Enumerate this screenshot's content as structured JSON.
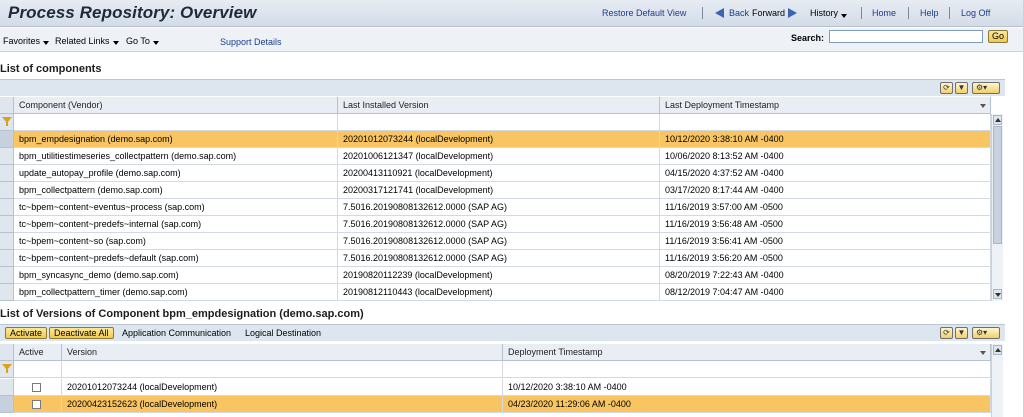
{
  "header": {
    "title": "Process Repository: Overview",
    "restore_default_view": "Restore Default View",
    "back": "Back",
    "forward": "Forward",
    "history": "History",
    "home": "Home",
    "help": "Help",
    "logoff": "Log Off"
  },
  "toolbar": {
    "favorites": "Favorites",
    "related_links": "Related Links",
    "go_to": "Go To",
    "support_details": "Support Details",
    "search_label": "Search:",
    "search_value": "",
    "go_label": "Go"
  },
  "components": {
    "title": "List of components",
    "columns": [
      "Component (Vendor)",
      "Last Installed Version",
      "Last Deployment Timestamp"
    ],
    "rows": [
      {
        "component": "bpm_empdesignation (demo.sap.com)",
        "version": "20201012073244 (localDevelopment)",
        "timestamp": "10/12/2020 3:38:10 AM -0400",
        "selected": true
      },
      {
        "component": "bpm_utilitiestimeseries_collectpattern (demo.sap.com)",
        "version": "20201006121347 (localDevelopment)",
        "timestamp": "10/06/2020 8:13:52 AM -0400",
        "selected": false
      },
      {
        "component": "update_autopay_profile (demo.sap.com)",
        "version": "20200413110921 (localDevelopment)",
        "timestamp": "04/15/2020 4:37:52 AM -0400",
        "selected": false
      },
      {
        "component": "bpm_collectpattern (demo.sap.com)",
        "version": "20200317121741 (localDevelopment)",
        "timestamp": "03/17/2020 8:17:44 AM -0400",
        "selected": false
      },
      {
        "component": "tc~bpem~content~eventus~process (sap.com)",
        "version": "7.5016.20190808132612.0000 (SAP AG)",
        "timestamp": "11/16/2019 3:57:00 AM -0500",
        "selected": false
      },
      {
        "component": "tc~bpem~content~predefs~internal (sap.com)",
        "version": "7.5016.20190808132612.0000 (SAP AG)",
        "timestamp": "11/16/2019 3:56:48 AM -0500",
        "selected": false
      },
      {
        "component": "tc~bpem~content~so (sap.com)",
        "version": "7.5016.20190808132612.0000 (SAP AG)",
        "timestamp": "11/16/2019 3:56:41 AM -0500",
        "selected": false
      },
      {
        "component": "tc~bpem~content~predefs~default (sap.com)",
        "version": "7.5016.20190808132612.0000 (SAP AG)",
        "timestamp": "11/16/2019 3:56:20 AM -0500",
        "selected": false
      },
      {
        "component": "bpm_syncasync_demo (demo.sap.com)",
        "version": "20190820112239 (localDevelopment)",
        "timestamp": "08/20/2019 7:22:43 AM -0400",
        "selected": false
      },
      {
        "component": "bpm_collectpattern_timer (demo.sap.com)",
        "version": "20190812110443 (localDevelopment)",
        "timestamp": "08/12/2019 7:04:47 AM -0400",
        "selected": false
      }
    ]
  },
  "versions": {
    "title": "List of Versions of Component bpm_empdesignation (demo.sap.com)",
    "activate": "Activate",
    "deactivate_all": "Deactivate All",
    "application_communication": "Application Communication",
    "logical_destination": "Logical Destination",
    "columns": [
      "Active",
      "Version",
      "Deployment Timestamp"
    ],
    "rows": [
      {
        "version": "20201012073244 (localDevelopment)",
        "timestamp": "10/12/2020 3:38:10 AM -0400",
        "selected": false
      },
      {
        "version": "20200423152623 (localDevelopment)",
        "timestamp": "04/23/2020 11:29:06 AM -0400",
        "selected": true
      }
    ]
  },
  "colors": {
    "selected_row": "#f8c562",
    "link": "#1a3d8f",
    "header_bg": "#dde6ef"
  }
}
